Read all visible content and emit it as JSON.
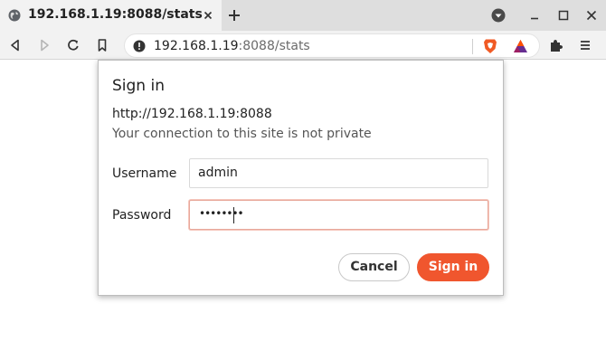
{
  "tab": {
    "title": "192.168.1.19:8088/stats"
  },
  "omnibox": {
    "host": "192.168.1.19",
    "rest": ":8088/stats"
  },
  "dialog": {
    "title": "Sign in",
    "origin": "http://192.168.1.19:8088",
    "warning": "Your connection to this site is not private",
    "username_label": "Username",
    "username_value": "admin",
    "password_label": "Password",
    "password_mask": "••••••••",
    "cancel_label": "Cancel",
    "signin_label": "Sign in"
  },
  "icons": {
    "favicon": "globe-icon",
    "tab_close": "close-icon",
    "new_tab": "plus-icon",
    "window_menu": "window-menu-icon",
    "minimize": "minimize-icon",
    "maximize": "maximize-icon",
    "close_window": "close-window-icon",
    "back": "back-icon",
    "forward": "forward-icon",
    "reload": "reload-icon",
    "bookmark": "bookmark-icon",
    "site_info": "info-icon",
    "brave_shields": "brave-shields-icon",
    "brave_rewards": "rewards-icon",
    "extensions": "extensions-icon",
    "menu": "menu-icon"
  },
  "colors": {
    "accent": "#f0562e",
    "focus_border": "#e8a89b",
    "brave_orange": "#f05a24",
    "rewards_purple": "#662d91"
  }
}
